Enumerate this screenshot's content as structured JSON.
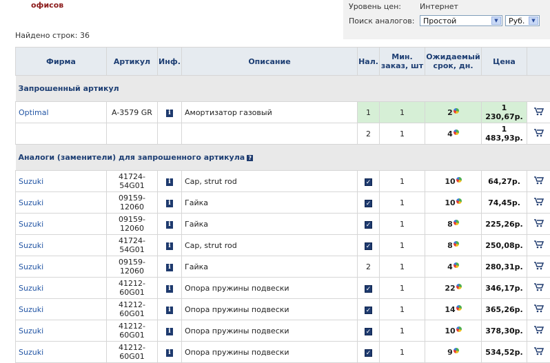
{
  "header": {
    "offices_text": "офисов",
    "found_text": "Найдено строк: 36"
  },
  "side_panel": {
    "price_level_label": "Уровень цен:",
    "price_level_value": "Интернет",
    "analog_search_label": "Поиск аналогов:",
    "analog_search_value": "Простой",
    "currency_value": "Руб."
  },
  "table": {
    "columns": [
      "Фирма",
      "Артикул",
      "Инф.",
      "Описание",
      "Нал.",
      "Мин. заказ, шт",
      "Ожидаемый срок, дн.",
      "Цена"
    ],
    "requested_section": "Запрошенный артикул",
    "requested_rows": [
      {
        "brand": "Optimal",
        "article": "A-3579 GR",
        "desc": "Амортизатор газовый",
        "stock": "1",
        "min": "1",
        "days": "2",
        "price": "1 230,67р."
      },
      {
        "brand": "",
        "article": "",
        "desc": "",
        "stock": "2",
        "min": "1",
        "days": "4",
        "price": "1 483,93р."
      }
    ],
    "analogs_section": "Аналоги (заменители) для запрошенного артикула",
    "analog_rows": [
      {
        "brand": "Suzuki",
        "article": "41724-54G01",
        "desc": "Cap, strut rod",
        "stock": "check",
        "min": "1",
        "days": "10",
        "price": "64,27р."
      },
      {
        "brand": "Suzuki",
        "article": "09159-12060",
        "desc": "Гайка",
        "stock": "check",
        "min": "1",
        "days": "10",
        "price": "74,45р."
      },
      {
        "brand": "Suzuki",
        "article": "09159-12060",
        "desc": "Гайка",
        "stock": "check",
        "min": "1",
        "days": "8",
        "price": "225,26р."
      },
      {
        "brand": "Suzuki",
        "article": "41724-54G01",
        "desc": "Cap, strut rod",
        "stock": "check",
        "min": "1",
        "days": "8",
        "price": "250,08р."
      },
      {
        "brand": "Suzuki",
        "article": "09159-12060",
        "desc": "Гайка",
        "stock": "2",
        "min": "1",
        "days": "4",
        "price": "280,31р."
      },
      {
        "brand": "Suzuki",
        "article": "41212-60G01",
        "desc": "Опора пружины подвески",
        "stock": "check",
        "min": "1",
        "days": "22",
        "price": "346,17р."
      },
      {
        "brand": "Suzuki",
        "article": "41212-60G01",
        "desc": "Опора пружины подвески",
        "stock": "check",
        "min": "1",
        "days": "14",
        "price": "365,26р."
      },
      {
        "brand": "Suzuki",
        "article": "41212-60G01",
        "desc": "Опора пружины подвески",
        "stock": "check",
        "min": "1",
        "days": "10",
        "price": "378,30р."
      },
      {
        "brand": "Suzuki",
        "article": "41212-60G01",
        "desc": "Опора пружины подвески",
        "stock": "check",
        "min": "1",
        "days": "9",
        "price": "534,52р."
      }
    ]
  },
  "icons": {
    "info": "info-icon",
    "stock_available": "checkbox-icon",
    "delivery_chart": "pie-chart-icon",
    "cart": "cart-icon",
    "help": "help-icon"
  },
  "colors": {
    "header_text": "#1d3e73",
    "link": "#2255a4",
    "highlight_row": "#d6efd6",
    "offices": "#8b1a1a"
  }
}
